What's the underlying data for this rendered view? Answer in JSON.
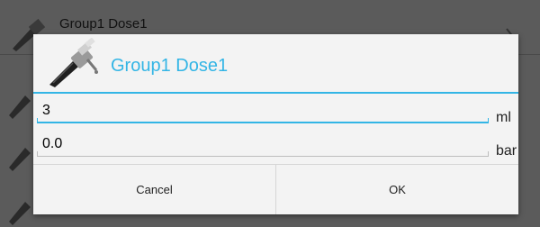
{
  "background": {
    "item_title": "Group1 Dose1"
  },
  "dialog": {
    "title": "Group1 Dose1",
    "icon": "portafilter-icon",
    "fields": [
      {
        "value": "3",
        "unit": "ml",
        "focused": true
      },
      {
        "value": "0.0",
        "unit": "bar",
        "focused": false
      }
    ],
    "cancel_label": "Cancel",
    "ok_label": "OK"
  },
  "colors": {
    "accent": "#33b5e5",
    "dialog_bg": "#f3f3f3",
    "scrim": "#5b5b5b"
  }
}
